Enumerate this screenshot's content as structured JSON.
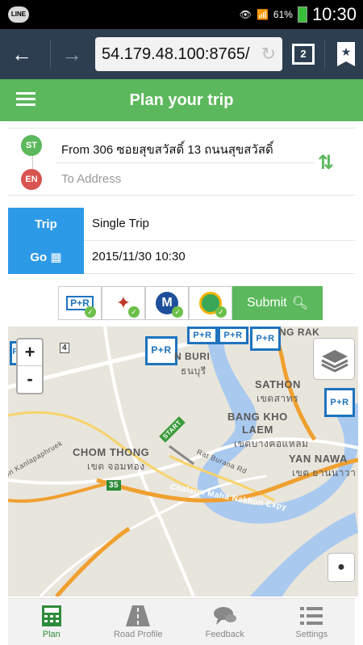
{
  "statusbar": {
    "line_label": "LINE",
    "battery": "61%",
    "time": "10:30"
  },
  "browser": {
    "url": "54.179.48.100:8765/",
    "tab_count": "2"
  },
  "header": {
    "title": "Plan your trip"
  },
  "address": {
    "start_badge": "ST",
    "end_badge": "EN",
    "from_text": "From 306 ซอยสุขสวัสดิ์ 13 ถนนสุขสวัสดิ์",
    "to_placeholder": "To Address"
  },
  "form": {
    "trip_label": "Trip",
    "trip_value": "Single Trip",
    "go_label": "Go",
    "go_value": "2015/11/30 10:30"
  },
  "modes": {
    "items": [
      {
        "name": "park-and-ride",
        "label": "P+R",
        "selected": true
      },
      {
        "name": "bts",
        "label": "",
        "selected": true
      },
      {
        "name": "mrt",
        "label": "M",
        "selected": true
      },
      {
        "name": "airport-link",
        "label": "",
        "selected": true
      }
    ],
    "submit_label": "Submit"
  },
  "map": {
    "zoom_in": "+",
    "zoom_out": "-",
    "markers": [
      "P+R",
      "P+R",
      "P+R",
      "P+R",
      "P+R",
      "P+R"
    ],
    "labels": {
      "ng_rak": "NG RAK",
      "n_buri": "N BURI",
      "n_buri_th": "ธนบุรี",
      "sathon": "SATHON",
      "sathon_th": "เขตสาทร",
      "bang_kho": "BANG KHO",
      "laem": "LAEM",
      "laem_th": "เขตบางคอแหลม",
      "chom_thong": "CHOM THONG",
      "chom_thong_th": "เขต จอมทอง",
      "yan_nawa": "YAN NAWA",
      "yan_nawa_th": "เขต ยานนาวา",
      "rat_burana": "Rat Burana Rd",
      "chalerm": "Chalerm Maha Nakhon Expy",
      "kanlapaphruek": "hon Kanlapaphruek",
      "start_flag": "START",
      "route_35": "35",
      "route_4": "4"
    }
  },
  "bottomnav": {
    "items": [
      {
        "label": "Plan",
        "active": true
      },
      {
        "label": "Road Profile",
        "active": false
      },
      {
        "label": "Feedback",
        "active": false
      },
      {
        "label": "Settings",
        "active": false
      }
    ]
  },
  "colors": {
    "accent_green": "#5cb85c",
    "label_blue": "#2d9ae8",
    "browser_bar": "#2c3e50",
    "route_orange": "#f0a030"
  }
}
